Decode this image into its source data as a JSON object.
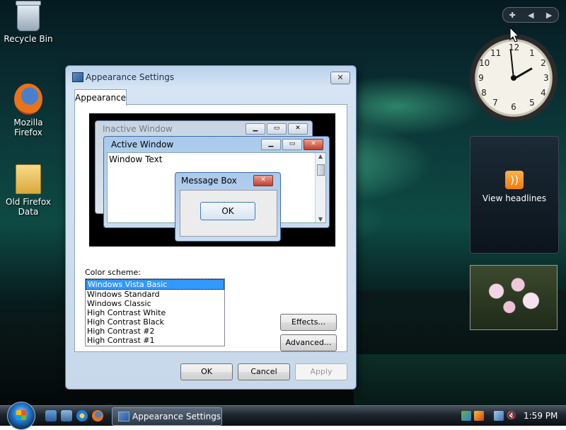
{
  "desktop": {
    "icons": [
      {
        "label": "Recycle Bin",
        "icon": "recycle-bin-icon"
      },
      {
        "label": "Mozilla Firefox",
        "icon": "firefox-icon"
      },
      {
        "label": "Old Firefox\nData",
        "icon": "folder-icon"
      }
    ]
  },
  "gadgets": {
    "clock": {
      "numbers": [
        "12",
        "1",
        "2",
        "3",
        "4",
        "5",
        "6",
        "7",
        "8",
        "9",
        "10",
        "11"
      ],
      "time": "1:59"
    },
    "feeds": {
      "label": "View headlines"
    }
  },
  "dialog": {
    "title": "Appearance Settings",
    "close_label": "✕",
    "tab_label": "Appearance",
    "preview": {
      "inactive_title": "Inactive Window",
      "active_title": "Active Window",
      "window_text": "Window Text",
      "message_title": "Message Box",
      "ok_label": "OK"
    },
    "color_scheme_label": "Color scheme:",
    "schemes": [
      "Windows Vista Basic",
      "Windows Standard",
      "Windows Classic",
      "High Contrast White",
      "High Contrast Black",
      "High Contrast #2",
      "High Contrast #1"
    ],
    "selected_index": 0,
    "effects_label": "Effects...",
    "advanced_label": "Advanced...",
    "ok_label": "OK",
    "cancel_label": "Cancel",
    "apply_label": "Apply"
  },
  "taskbar": {
    "active_window": "Appearance Settings",
    "time": "1:59 PM"
  }
}
